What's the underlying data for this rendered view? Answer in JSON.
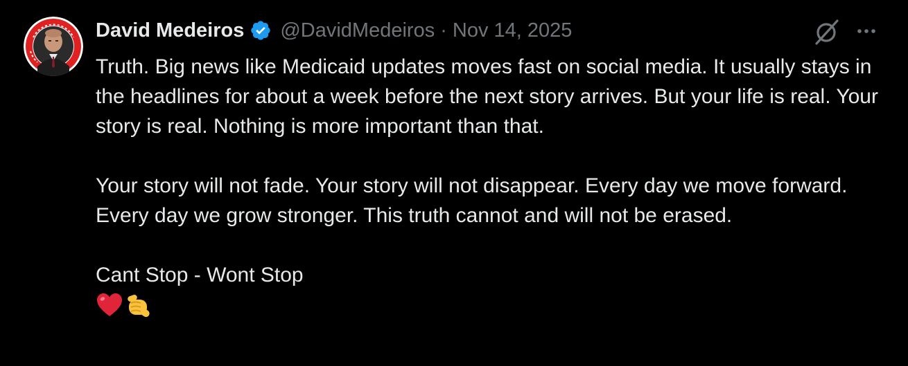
{
  "author": {
    "name": "David Medeiros",
    "handle": "@DavidMedeiros",
    "separator": "·",
    "date": "Nov 14, 2025",
    "verified": true
  },
  "icons": {
    "verified": "verified-badge-icon",
    "grok": "grok-slash-circle-icon",
    "more": "more-dots-icon",
    "emoji_1": "red-heart-emoji",
    "emoji_2": "pointing-hand-emoji"
  },
  "post": {
    "paragraph_1": "Truth. Big news like Medicaid updates moves fast on social media. It usually stays in the headlines for about a week before the next story arrives. But your life is real. Your story is real. Nothing is more important than that.",
    "paragraph_2": "Your story will not fade. Your story will not disappear. Every day we move forward. Every day we grow stronger. This truth cannot and will not be erased.",
    "paragraph_3": "Cant Stop - Wont Stop"
  },
  "colors": {
    "background": "#000000",
    "primary_text": "#e7e9ea",
    "secondary_text": "#71767b",
    "verified_blue": "#1d9bf0",
    "heart_red": "#e0243a",
    "hand_yellow": "#f9c23c"
  }
}
